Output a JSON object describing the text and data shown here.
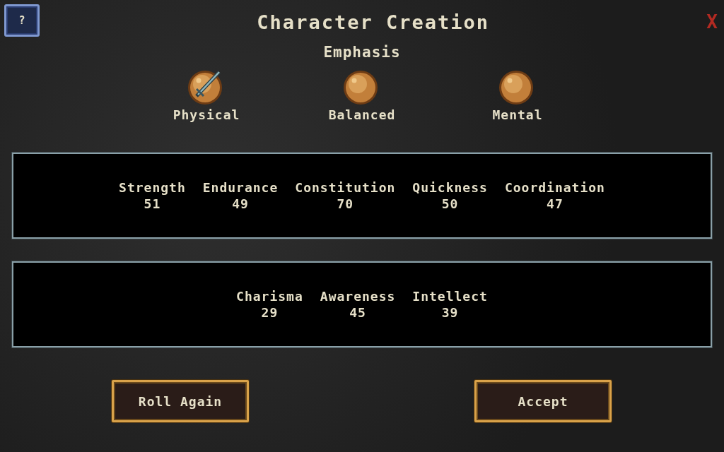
{
  "help_button": "?",
  "title": "Character Creation",
  "close_button": "X",
  "emphasis": {
    "heading": "Emphasis",
    "options": [
      {
        "label": "Physical",
        "selected": true
      },
      {
        "label": "Balanced",
        "selected": false
      },
      {
        "label": "Mental",
        "selected": false
      }
    ]
  },
  "stat_panels": [
    {
      "stats": [
        {
          "name": "Strength",
          "value": "51"
        },
        {
          "name": "Endurance",
          "value": "49"
        },
        {
          "name": "Constitution",
          "value": "70"
        },
        {
          "name": "Quickness",
          "value": "50"
        },
        {
          "name": "Coordination",
          "value": "47"
        }
      ]
    },
    {
      "stats": [
        {
          "name": "Charisma",
          "value": "29"
        },
        {
          "name": "Awareness",
          "value": "45"
        },
        {
          "name": "Intellect",
          "value": "39"
        }
      ]
    }
  ],
  "buttons": [
    "Roll Again",
    "Accept"
  ]
}
